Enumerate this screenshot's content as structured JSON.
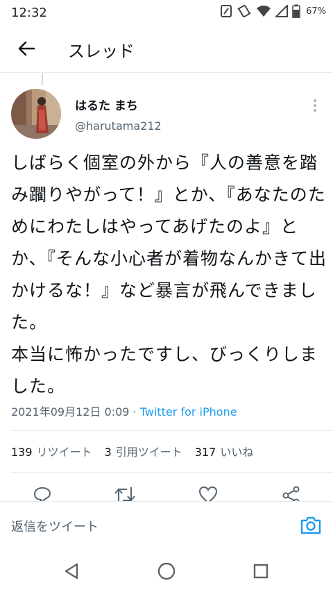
{
  "status_bar": {
    "time": "12:32",
    "battery_percent": "67%",
    "icons": [
      "nfc-icon",
      "vibrate-icon",
      "wifi-icon",
      "signal-icon",
      "battery-icon"
    ]
  },
  "app_bar": {
    "title": "スレッド",
    "back_icon": "arrow-left-icon"
  },
  "tweet": {
    "display_name": "はるた まち",
    "username": "@harutama212",
    "text": "しばらく個室の外から『人の善意を踏み躙りやがって！』とか、『あなたのためにわたしはやってあげたのよ』とか、『そんな小心者が着物なんかきて出かけるな！』など暴言が飛んできました。\n本当に怖かったですし、びっくりしました。",
    "date": "2021年09月12日 0:09",
    "separator": "·",
    "source": "Twitter for iPhone",
    "stats": {
      "retweets_count": "139",
      "retweets_label": "リツイート",
      "quotes_count": "3",
      "quotes_label": "引用ツイート",
      "likes_count": "317",
      "likes_label": "いいね"
    }
  },
  "reply_bar": {
    "placeholder": "返信をツイート"
  },
  "colors": {
    "accent": "#1d9bf0",
    "text": "#0f1419",
    "secondary": "#536471",
    "divider": "#e6ecf0"
  }
}
